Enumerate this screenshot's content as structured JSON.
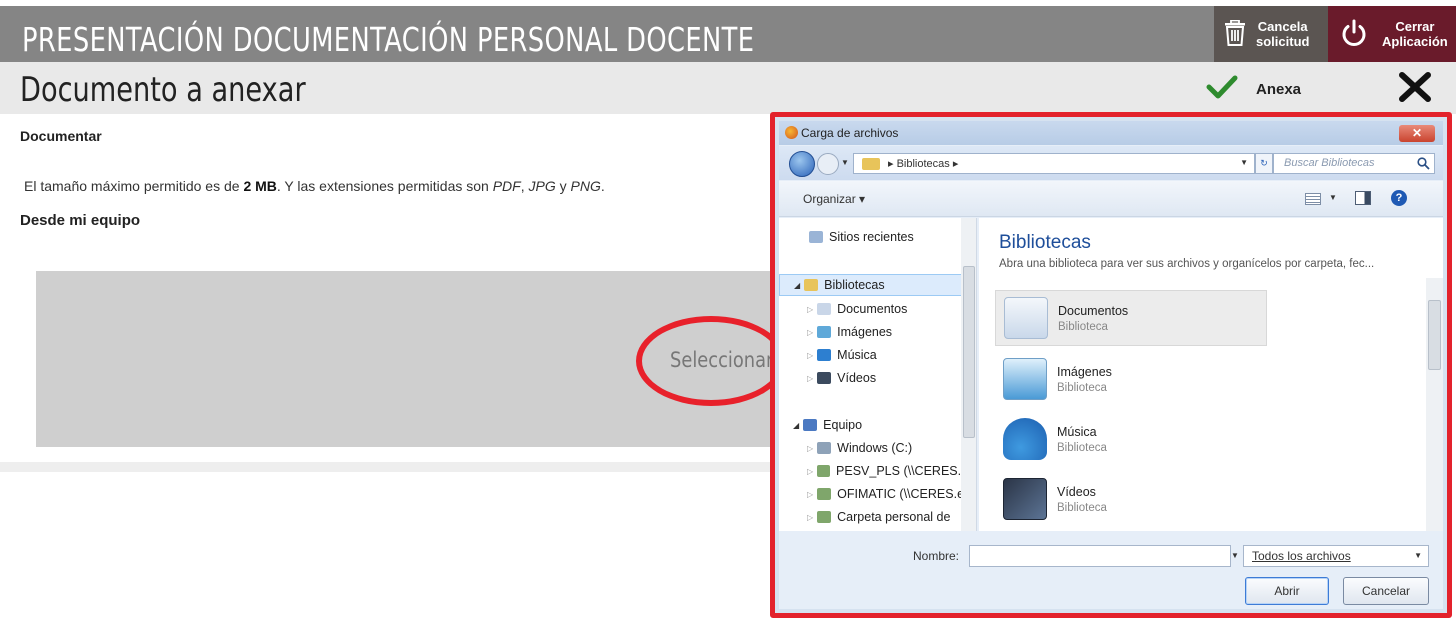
{
  "header": {
    "title": "PRESENTACIÓN DOCUMENTACIÓN PERSONAL DOCENTE",
    "cancel_label_1": "Cancela",
    "cancel_label_2": "solicitud",
    "close_label_1": "Cerrar",
    "close_label_2": "Aplicación"
  },
  "subheader": {
    "title": "Documento a anexar",
    "attach_label": "Anexa"
  },
  "content": {
    "section_label": "Documentar",
    "info_prefix": "El tamaño máximo permitido es de ",
    "max_size": "2 MB",
    "info_middle": ". Y las extensiones permitidas son ",
    "ext_pdf": "PDF",
    "ext_jpg": "JPG",
    "ext_png": "PNG",
    "info_y": " y ",
    "info_comma": ", ",
    "info_end": ".",
    "source_label": "Desde mi equipo",
    "select_label": "Seleccionar"
  },
  "dialog": {
    "title": "Carga de archivos",
    "path": "▸ Bibliotecas ▸",
    "search_placeholder": "Buscar Bibliotecas",
    "organize": "Organizar ▾",
    "nav_items": [
      {
        "label": "Sitios recientes"
      },
      {
        "label": "Bibliotecas"
      },
      {
        "label": "Documentos"
      },
      {
        "label": "Imágenes"
      },
      {
        "label": "Música"
      },
      {
        "label": "Vídeos"
      },
      {
        "label": "Equipo"
      },
      {
        "label": "Windows (C:)"
      },
      {
        "label": "PESV_PLS (\\\\CERES.ed"
      },
      {
        "label": "OFIMATIC (\\\\CERES.e"
      },
      {
        "label": "Carpeta personal de"
      }
    ],
    "library_title": "Bibliotecas",
    "library_subtitle": "Abra una biblioteca para ver sus archivos y organícelos por carpeta, fec...",
    "libraries": [
      {
        "name": "Documentos",
        "type": "Biblioteca"
      },
      {
        "name": "Imágenes",
        "type": "Biblioteca"
      },
      {
        "name": "Música",
        "type": "Biblioteca"
      },
      {
        "name": "Vídeos",
        "type": "Biblioteca"
      }
    ],
    "filename_label": "Nombre:",
    "filename_value": "",
    "file_filter": "Todos los archivos",
    "open_button": "Abrir",
    "cancel_button": "Cancelar"
  },
  "colors": {
    "header_bar": "#858585",
    "cancel_bg": "#5b5552",
    "close_bg": "#6a1b2b",
    "check_green": "#2e8b2e",
    "highlight_red": "#e8212b"
  }
}
